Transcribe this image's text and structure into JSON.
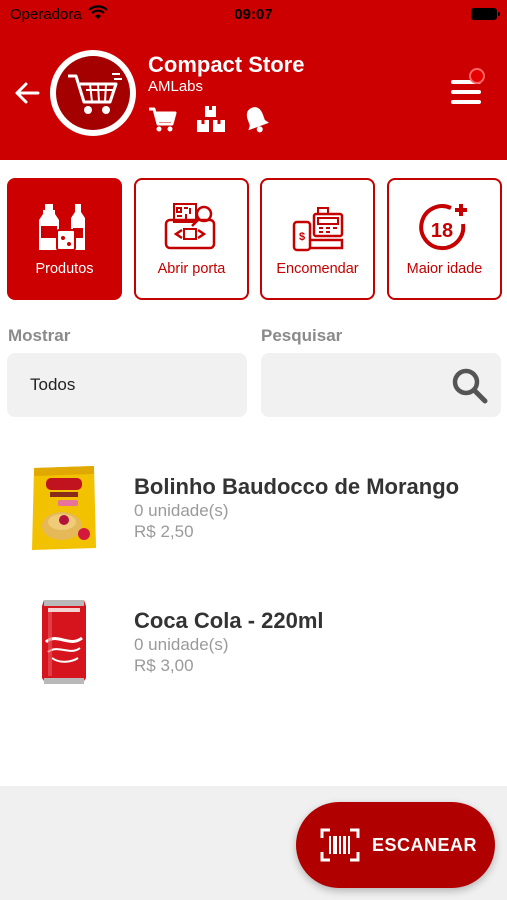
{
  "status_bar": {
    "carrier": "Operadora",
    "time": "09:07"
  },
  "header": {
    "store_name": "Compact Store",
    "store_sub": "AMLabs",
    "accent_color": "#cc0000"
  },
  "categories": [
    {
      "label": "Produtos",
      "icon": "products-icon",
      "active": true
    },
    {
      "label": "Abrir porta",
      "icon": "open-door-icon",
      "active": false
    },
    {
      "label": "Encomendar",
      "icon": "order-icon",
      "active": false
    },
    {
      "label": "Maior idade",
      "icon": "18-plus-icon",
      "active": false
    }
  ],
  "filters": {
    "show_label": "Mostrar",
    "show_value": "Todos",
    "search_label": "Pesquisar",
    "search_placeholder": ""
  },
  "products": [
    {
      "name": "Bolinho Baudocco de Morango",
      "qty": "0 unidade(s)",
      "price": "R$ 2,50"
    },
    {
      "name": "Coca Cola - 220ml",
      "qty": "0 unidade(s)",
      "price": "R$ 3,00"
    }
  ],
  "scan_button": {
    "label": "ESCANEAR"
  }
}
